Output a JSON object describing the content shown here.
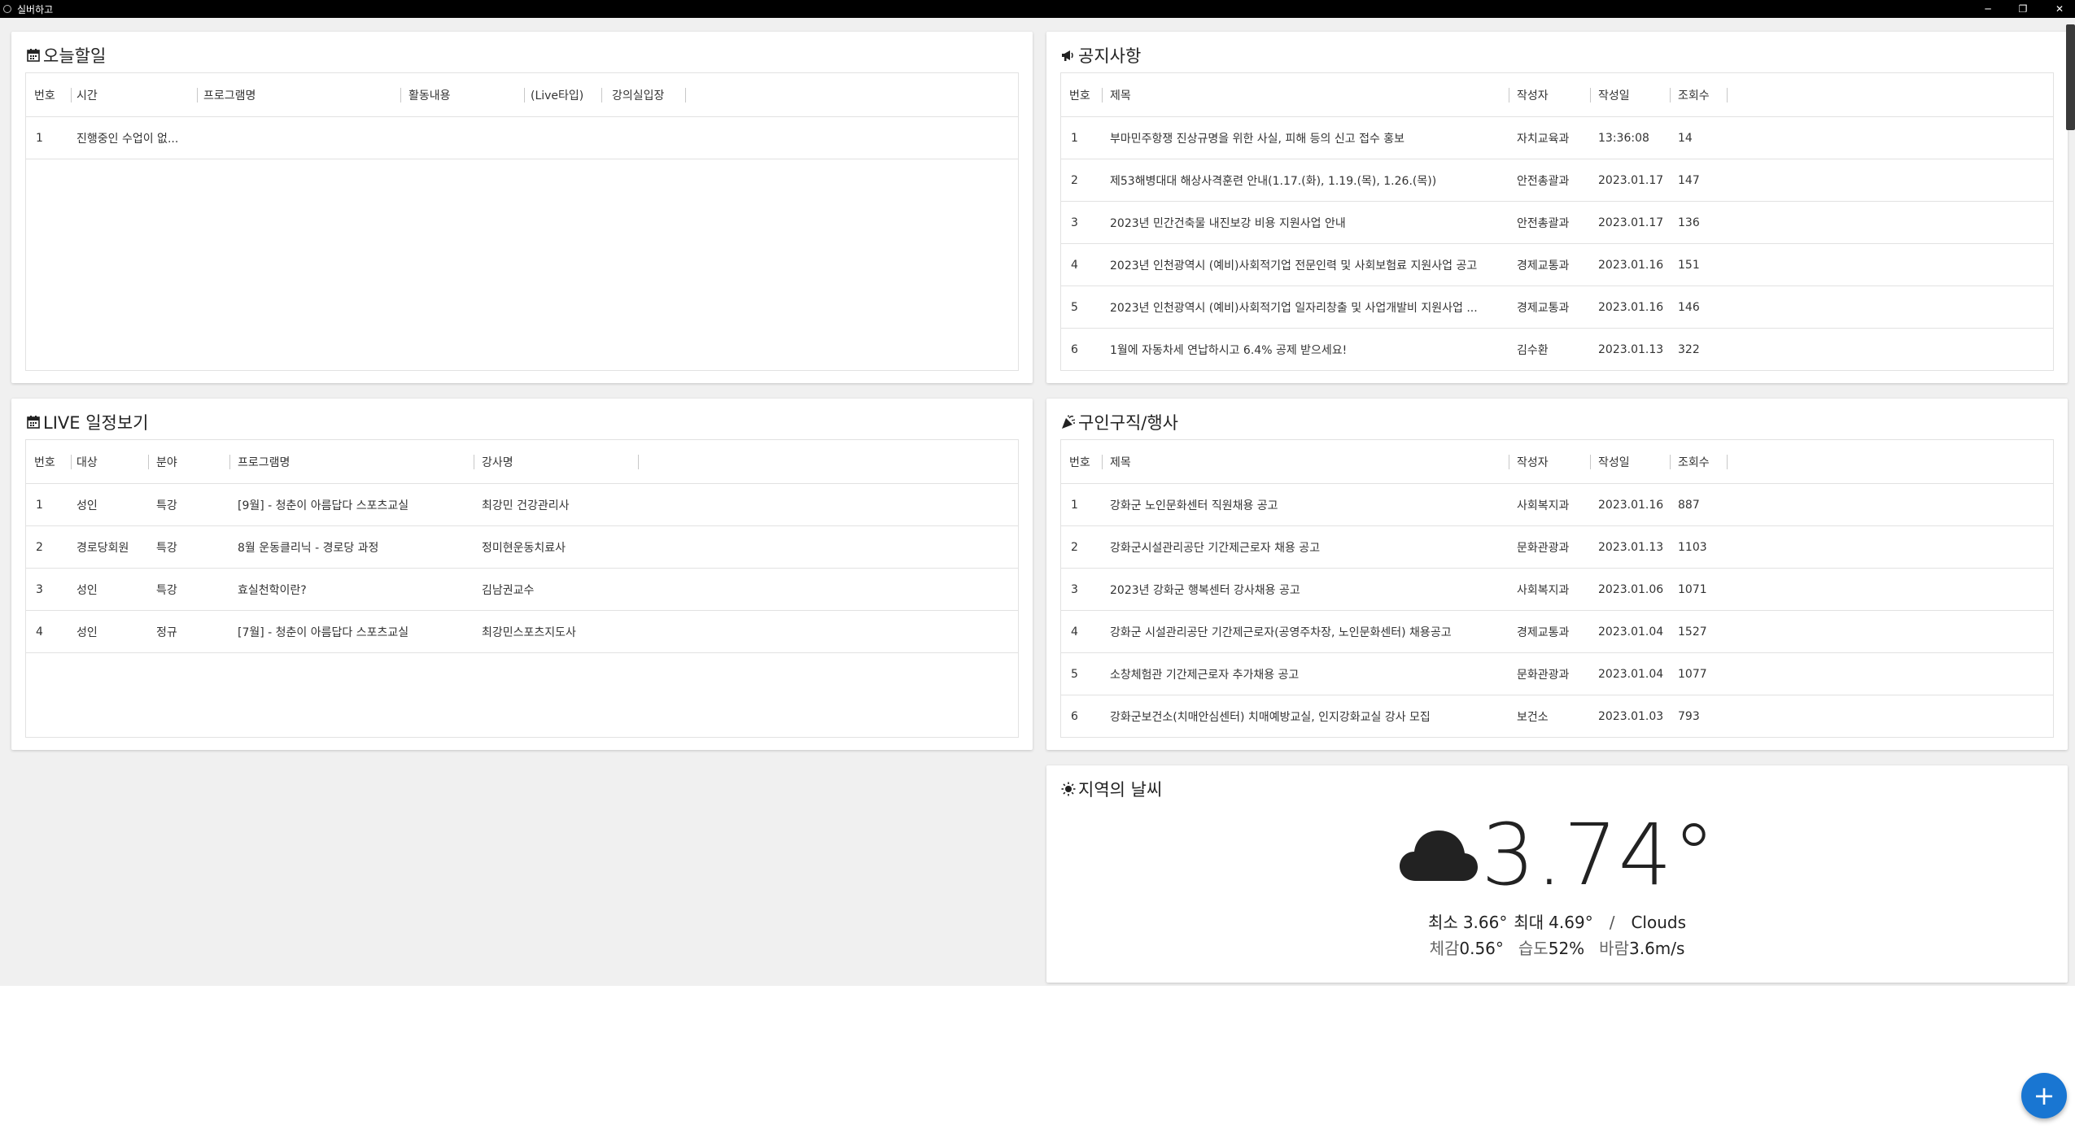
{
  "window": {
    "title": "실버하고",
    "minimize": "─",
    "maximize": "❐",
    "close": "✕"
  },
  "today": {
    "title": "오늘할일",
    "headers": [
      "번호",
      "시간",
      "프로그램명",
      "활동내용",
      "(Live타입)",
      "강의실입장"
    ],
    "rows": [
      [
        "1",
        "진행중인 수업이 없...",
        "",
        "",
        "",
        ""
      ]
    ]
  },
  "notice": {
    "title": "공지사항",
    "headers": [
      "번호",
      "제목",
      "작성자",
      "작성일",
      "조회수"
    ],
    "rows": [
      [
        "1",
        "부마민주항쟁 진상규명을 위한 사실, 피해 등의 신고 접수 홍보",
        "자치교육과",
        "13:36:08",
        "14"
      ],
      [
        "2",
        "제53해병대대 해상사격훈련 안내(1.17.(화), 1.19.(목), 1.26.(목))",
        "안전총괄과",
        "2023.01.17",
        "147"
      ],
      [
        "3",
        "2023년 민간건축물 내진보강 비용 지원사업 안내",
        "안전총괄과",
        "2023.01.17",
        "136"
      ],
      [
        "4",
        "2023년 인천광역시 (예비)사회적기업 전문인력 및 사회보험료 지원사업 공고",
        "경제교통과",
        "2023.01.16",
        "151"
      ],
      [
        "5",
        "2023년 인천광역시 (예비)사회적기업 일자리창출 및 사업개발비 지원사업 ...",
        "경제교통과",
        "2023.01.16",
        "146"
      ],
      [
        "6",
        "1월에 자동차세 연납하시고 6.4% 공제 받으세요!",
        "김수환",
        "2023.01.13",
        "322"
      ]
    ]
  },
  "live": {
    "title": "LIVE 일정보기",
    "headers": [
      "번호",
      "대상",
      "분야",
      "프로그램명",
      "강사명"
    ],
    "rows": [
      [
        "1",
        "성인",
        "특강",
        "[9월] - 청춘이 아름답다 스포츠교실",
        "최강민 건강관리사"
      ],
      [
        "2",
        "경로당회원",
        "특강",
        "8월 운동클리닉 - 경로당 과정",
        "정미현운동치료사"
      ],
      [
        "3",
        "성인",
        "특강",
        "효실천학이란?",
        "김남권교수"
      ],
      [
        "4",
        "성인",
        "정규",
        "[7월] - 청춘이 아름답다 스포츠교실",
        "최강민스포츠지도사"
      ]
    ]
  },
  "jobs": {
    "title": "구인구직/행사",
    "headers": [
      "번호",
      "제목",
      "작성자",
      "작성일",
      "조회수"
    ],
    "rows": [
      [
        "1",
        "강화군 노인문화센터 직원채용 공고",
        "사회복지과",
        "2023.01.16",
        "887"
      ],
      [
        "2",
        "강화군시설관리공단 기간제근로자 채용 공고",
        "문화관광과",
        "2023.01.13",
        "1103"
      ],
      [
        "3",
        "2023년 강화군 행복센터 강사채용 공고",
        "사회복지과",
        "2023.01.06",
        "1071"
      ],
      [
        "4",
        "강화군 시설관리공단 기간제근로자(공영주차장, 노인문화센터) 채용공고",
        "경제교통과",
        "2023.01.04",
        "1527"
      ],
      [
        "5",
        "소창체험관 기간제근로자 추가채용 공고",
        "문화관광과",
        "2023.01.04",
        "1077"
      ],
      [
        "6",
        "강화군보건소(치매안심센터) 치매예방교실, 인지강화교실 강사 모집",
        "보건소",
        "2023.01.03",
        "793"
      ]
    ]
  },
  "weather": {
    "title": "지역의 날씨",
    "icon": "cloud-icon",
    "temp": "3.74°",
    "min_label": "최소",
    "min_value": "3.66°",
    "max_label": "최대",
    "max_value": "4.69°",
    "slash": "/",
    "condition": "Clouds",
    "feels_label": "체감",
    "feels_value": "0.56°",
    "humidity_label": "습도",
    "humidity_value": "52%",
    "wind_label": "바람",
    "wind_value": "3.6m/s"
  },
  "fab": {
    "label": "+"
  },
  "colors": {
    "accent": "#1976d2",
    "titlebar": "#000000",
    "background": "#f0f0f0"
  }
}
